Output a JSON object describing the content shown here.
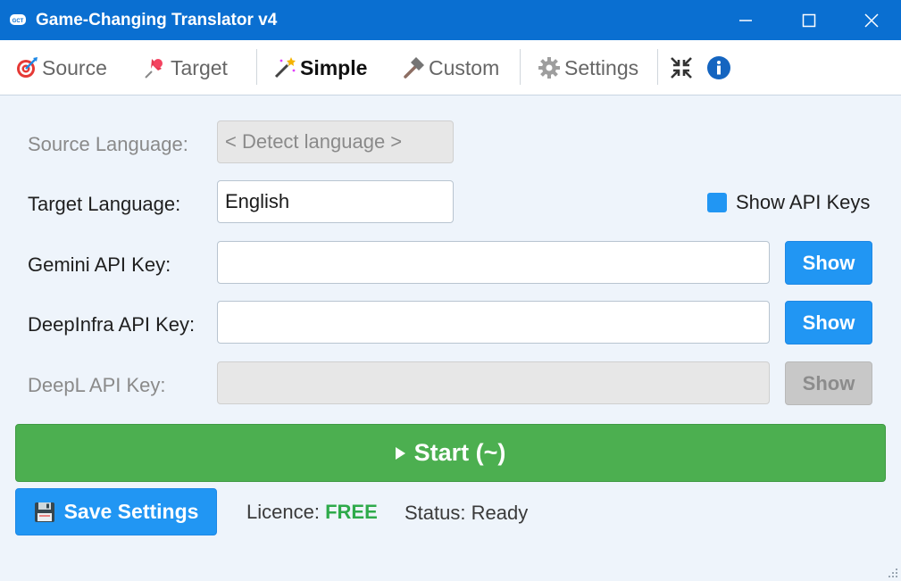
{
  "window": {
    "title": "Game-Changing Translator v4",
    "icon": "gct-controller-icon",
    "accent": "#0a6fd1"
  },
  "toolbar": {
    "tabs": [
      {
        "label": "Source",
        "icon": "target-icon",
        "active": false
      },
      {
        "label": "Target",
        "icon": "pushpin-icon",
        "active": false
      },
      {
        "label": "Simple",
        "icon": "magic-wand-icon",
        "active": true
      },
      {
        "label": "Custom",
        "icon": "hammer-icon",
        "active": false
      },
      {
        "label": "Settings",
        "icon": "gear-icon",
        "active": false
      }
    ],
    "extra_icons": [
      "compress-icon",
      "info-icon"
    ]
  },
  "form": {
    "source_language": {
      "label": "Source Language:",
      "value": "< Detect language >",
      "disabled": true
    },
    "target_language": {
      "label": "Target Language:",
      "value": "English"
    },
    "show_api_keys": {
      "label": "Show API Keys",
      "checked": true
    },
    "gemini": {
      "label": "Gemini API Key:",
      "value": "",
      "button": "Show"
    },
    "deepinfra": {
      "label": "DeepInfra API Key:",
      "value": "",
      "button": "Show"
    },
    "deepl": {
      "label": "DeepL API Key:",
      "value": "",
      "button": "Show",
      "disabled": true
    }
  },
  "actions": {
    "start_label": "Start (~)",
    "save_label": "Save Settings"
  },
  "footer": {
    "licence_label": "Licence:",
    "licence_value": "FREE",
    "status_text": "Status: Ready"
  },
  "colors": {
    "primary": "#2196f3",
    "start_green": "#4caf50",
    "free_green": "#2eaa4a"
  }
}
